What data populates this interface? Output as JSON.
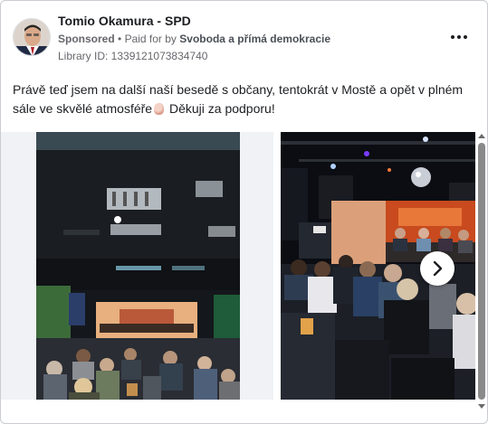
{
  "post": {
    "page_name": "Tomio Okamura - SPD",
    "sponsored_label": "Sponsored",
    "separator": "•",
    "paid_for_prefix": "Paid for by",
    "payer": "Svoboda a přímá demokracie",
    "library_id": "Library ID: 1339121073834740",
    "text_main": "Právě teď jsem na další naší besedě s občany, tentokrát v Mostě a opět v plném sále ve skvělé atmosféře",
    "text_end": "Děkuji za podporu!"
  },
  "icons": {
    "more": "more-options-icon",
    "emoji": "clapping-hands-emoji-icon",
    "next": "chevron-right-icon"
  },
  "colors": {
    "text_primary": "#1c1e21",
    "text_secondary": "#65676b",
    "card_border": "#c9ccd1",
    "carousel_gutter": "#f0f2f5"
  }
}
